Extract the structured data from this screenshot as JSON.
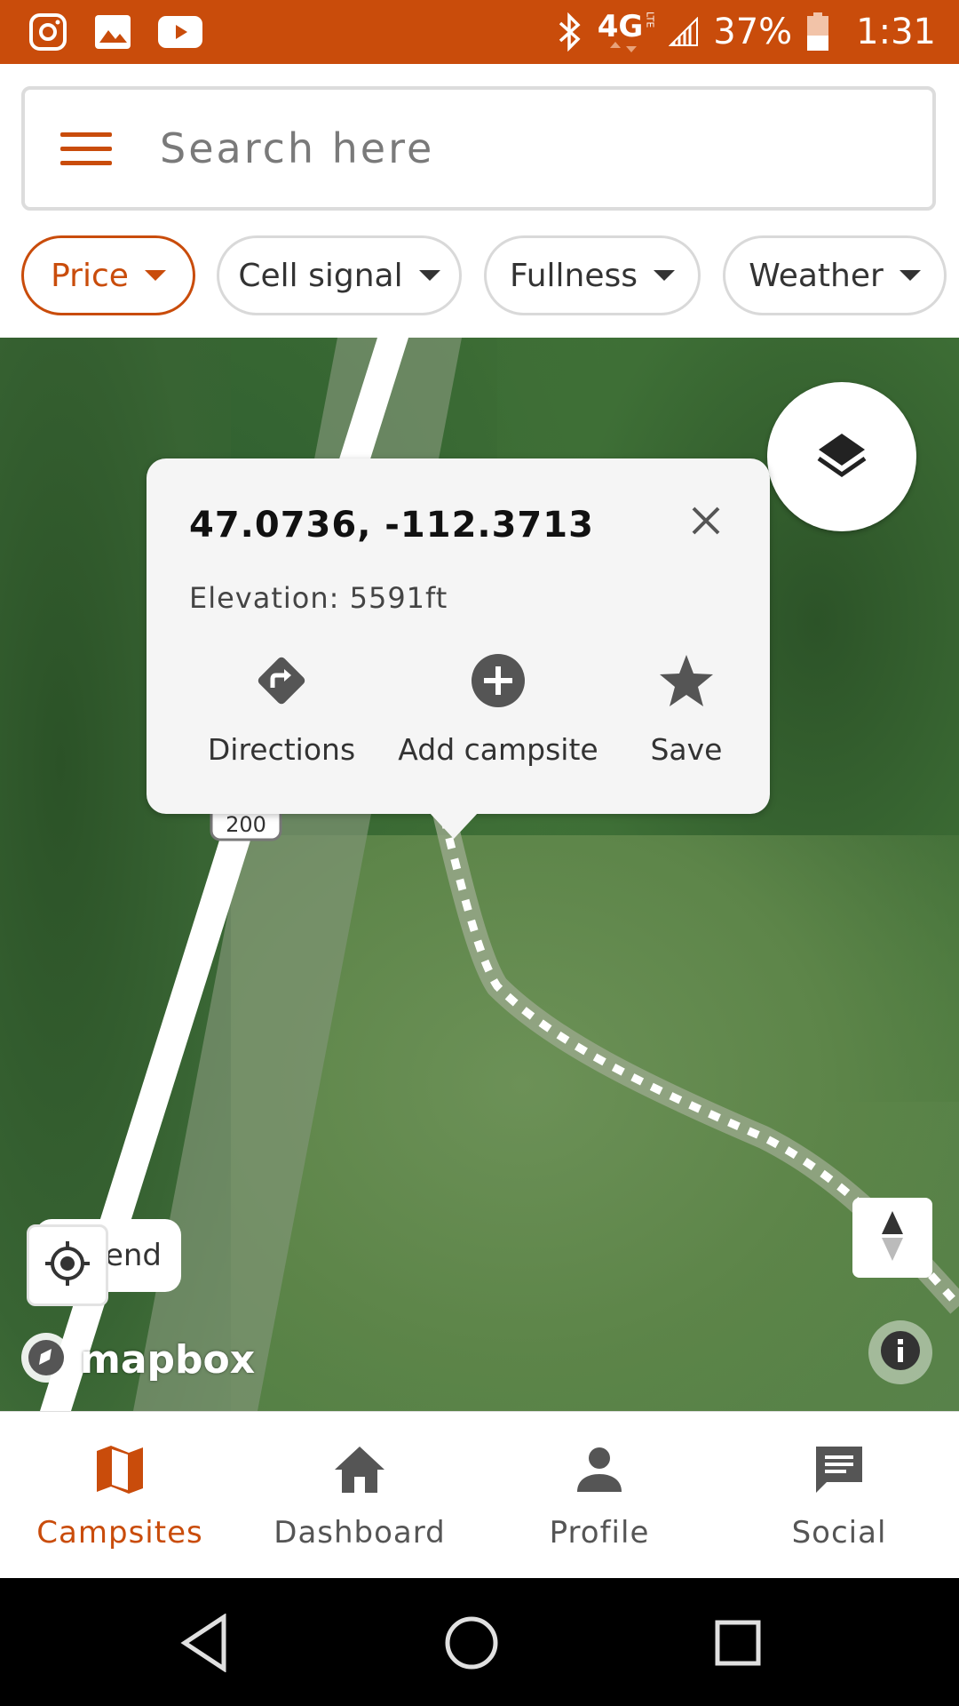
{
  "status_bar": {
    "network": "4G",
    "network_sub": "LTE",
    "battery_percent": "37%",
    "time": "1:31",
    "left_icons": [
      "instagram-icon",
      "gallery-icon",
      "youtube-icon"
    ],
    "right_icons": [
      "bluetooth-icon",
      "network-icon",
      "signal-icon",
      "battery-icon"
    ]
  },
  "search": {
    "placeholder": "Search here",
    "value": ""
  },
  "filters": [
    {
      "label": "Price",
      "active": true
    },
    {
      "label": "Cell signal",
      "active": false
    },
    {
      "label": "Fullness",
      "active": false
    },
    {
      "label": "Weather",
      "active": false
    }
  ],
  "popup": {
    "coordinates": "47.0736, -112.3713",
    "elevation": "Elevation: 5591ft",
    "actions": [
      {
        "label": "Directions",
        "icon": "directions-icon"
      },
      {
        "label": "Add campsite",
        "icon": "add-circle-icon"
      },
      {
        "label": "Save",
        "icon": "star-icon"
      }
    ]
  },
  "map": {
    "road_shield": "200",
    "legend_label": "Legend",
    "legend_visible_text": "end",
    "attribution": "mapbox"
  },
  "bottom_nav": [
    {
      "label": "Campsites",
      "icon": "map-icon",
      "active": true
    },
    {
      "label": "Dashboard",
      "icon": "home-icon",
      "active": false
    },
    {
      "label": "Profile",
      "icon": "person-icon",
      "active": false
    },
    {
      "label": "Social",
      "icon": "chat-icon",
      "active": false
    }
  ],
  "colors": {
    "accent": "#c94c0b",
    "status_bar": "#c94c0b",
    "inactive_text": "#555555"
  }
}
